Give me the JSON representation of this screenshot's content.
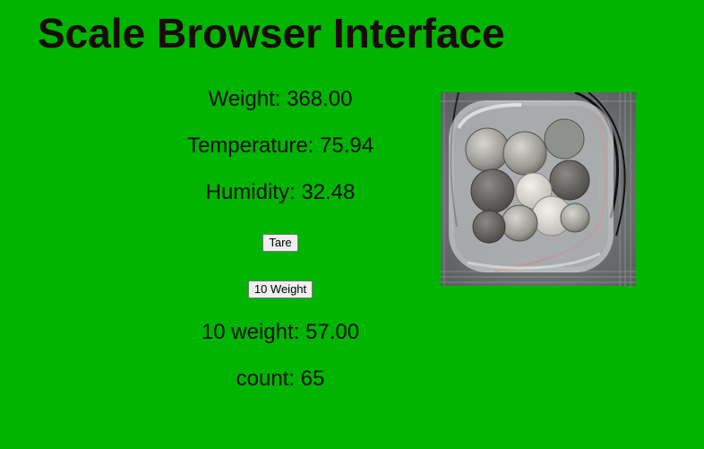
{
  "page": {
    "title": "Scale Browser Interface"
  },
  "readings": {
    "weight": "Weight: 368.00",
    "temperature": "Temperature: 75.94",
    "humidity": "Humidity: 32.48",
    "ten_weight": "10 weight: 57.00",
    "count": "count: 65"
  },
  "buttons": {
    "tare_label": "Tare",
    "ten_weight_label": "10 Weight"
  },
  "colors": {
    "background": "#00b400",
    "title_text": "#1a0a0a"
  }
}
